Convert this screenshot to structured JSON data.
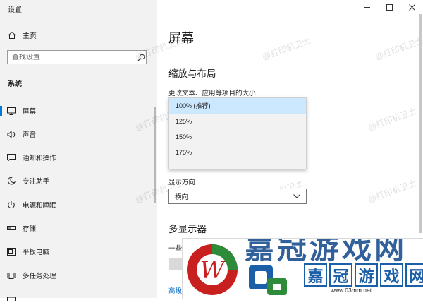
{
  "window": {
    "title": "设置"
  },
  "sidebar": {
    "home_label": "主页",
    "search_placeholder": "查找设置",
    "section_title": "系统",
    "items": [
      {
        "label": "屏幕",
        "icon": "monitor-icon",
        "active": true
      },
      {
        "label": "声音",
        "icon": "speaker-icon"
      },
      {
        "label": "通知和操作",
        "icon": "notification-icon"
      },
      {
        "label": "专注助手",
        "icon": "moon-icon"
      },
      {
        "label": "电源和睡眠",
        "icon": "power-icon"
      },
      {
        "label": "存储",
        "icon": "storage-icon"
      },
      {
        "label": "平板电脑",
        "icon": "tablet-icon"
      },
      {
        "label": "多任务处理",
        "icon": "multitask-icon"
      }
    ]
  },
  "main": {
    "page_title": "屏幕",
    "scale_section_title": "缩放与布局",
    "scale_label": "更改文本、应用等项目的大小",
    "scale_options": [
      "100% (推荐)",
      "125%",
      "150%",
      "175%"
    ],
    "orientation_label": "显示方向",
    "orientation_value": "横向",
    "multi_display_title": "多显示器",
    "partial_text": "一些",
    "advanced_link": "高级"
  },
  "watermark_text": "@打印机卫士",
  "overlay_logo": {
    "chars": [
      "嘉",
      "冠",
      "游",
      "戏",
      "网"
    ],
    "url": "www.03mm.net",
    "accent_red": "#c8201f",
    "accent_green": "#2e8b3a",
    "accent_blue": "#1b5fa8"
  },
  "colors": {
    "sidebar_bg": "#f2f2f2",
    "accent": "#0078d7",
    "selected_option": "#cce8ff",
    "link": "#0067c0"
  }
}
